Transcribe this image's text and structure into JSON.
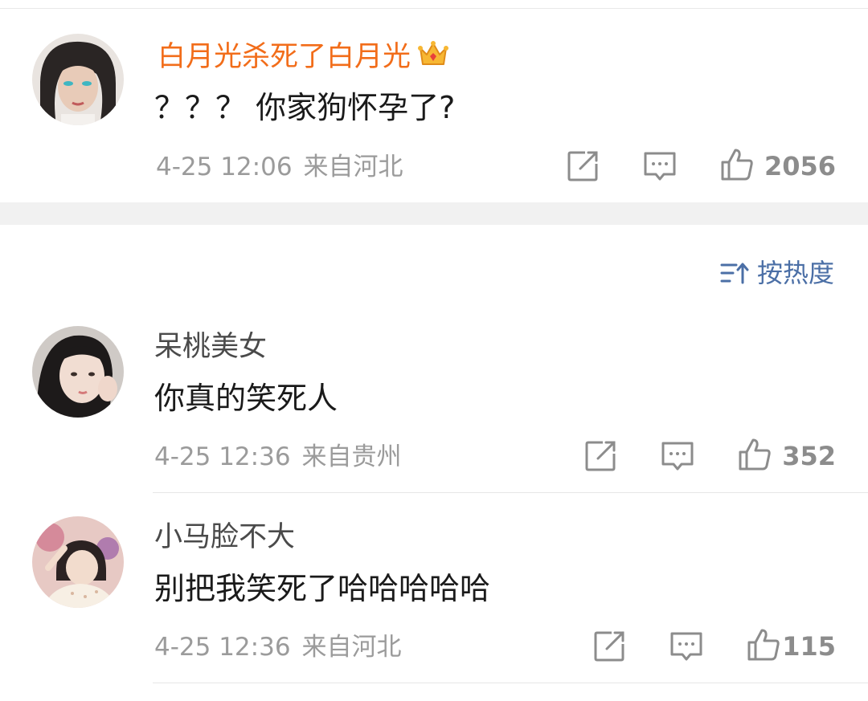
{
  "pinned_comment": {
    "username": "白月光杀死了白月光",
    "text": "？？？ 你家狗怀孕了?",
    "time": "4-25 12:06",
    "location": "来自河北",
    "likes": "2056",
    "badge_icon": "crown-icon"
  },
  "sort": {
    "label": "按热度",
    "icon": "sort-icon"
  },
  "comments": [
    {
      "username": "呆桃美女",
      "text": "你真的笑死人",
      "time": "4-25 12:36",
      "location": "来自贵州",
      "likes": "352"
    },
    {
      "username": "小马脸不大",
      "text": "别把我笑死了哈哈哈哈哈",
      "time": "4-25 12:36",
      "location": "来自河北",
      "likes": "115"
    }
  ],
  "colors": {
    "vip_name": "#f26d1a",
    "sort_link": "#4b6fa6",
    "meta_text": "#9b9b9b"
  }
}
